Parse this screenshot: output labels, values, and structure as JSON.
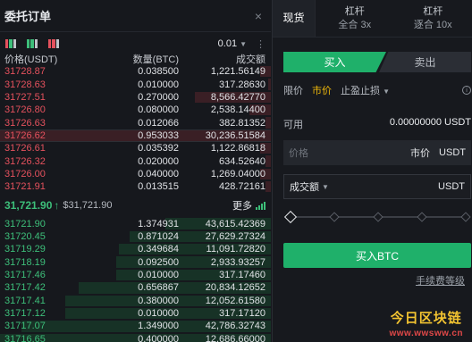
{
  "orderbook": {
    "title": "委托订单",
    "close_icon": "×",
    "precision": "0.01",
    "headers": {
      "price": "价格(USDT)",
      "qty": "数量(BTC)",
      "total": "成交额"
    },
    "asks": [
      {
        "price": "31728.87",
        "qty": "0.038500",
        "total": "1,221.56149",
        "depth": 0.04
      },
      {
        "price": "31728.63",
        "qty": "0.010000",
        "total": "317.28630",
        "depth": 0.01
      },
      {
        "price": "31727.51",
        "qty": "0.270000",
        "total": "8,566.42770",
        "depth": 0.28
      },
      {
        "price": "31726.80",
        "qty": "0.080000",
        "total": "2,538.14400",
        "depth": 0.08
      },
      {
        "price": "31726.63",
        "qty": "0.012066",
        "total": "382.81352",
        "depth": 0.02
      },
      {
        "price": "31726.62",
        "qty": "0.953033",
        "total": "30,236.51584",
        "depth": 1.0,
        "highlight": true
      },
      {
        "price": "31726.61",
        "qty": "0.035392",
        "total": "1,122.86818",
        "depth": 0.04
      },
      {
        "price": "31726.32",
        "qty": "0.020000",
        "total": "634.52640",
        "depth": 0.02
      },
      {
        "price": "31726.00",
        "qty": "0.040000",
        "total": "1,269.04000",
        "depth": 0.04
      },
      {
        "price": "31721.91",
        "qty": "0.013515",
        "total": "428.72161",
        "depth": 0.02
      }
    ],
    "last_price": "31,721.90",
    "mark_price": "$31,721.90",
    "more_label": "更多",
    "bids": [
      {
        "price": "31721.90",
        "qty": "1.374931",
        "total": "43,615.42369",
        "depth": 0.39
      },
      {
        "price": "31720.45",
        "qty": "0.871024",
        "total": "27,629.27324",
        "depth": 0.52
      },
      {
        "price": "31719.29",
        "qty": "0.349684",
        "total": "11,091.72820",
        "depth": 0.56
      },
      {
        "price": "31718.19",
        "qty": "0.092500",
        "total": "2,933.93257",
        "depth": 0.57
      },
      {
        "price": "31717.46",
        "qty": "0.010000",
        "total": "317.17460",
        "depth": 0.57
      },
      {
        "price": "31717.42",
        "qty": "0.656867",
        "total": "20,834.12652",
        "depth": 0.71
      },
      {
        "price": "31717.41",
        "qty": "0.380000",
        "total": "12,052.61580",
        "depth": 0.76
      },
      {
        "price": "31717.12",
        "qty": "0.010000",
        "total": "317.17120",
        "depth": 0.76
      },
      {
        "price": "31717.07",
        "qty": "1.349000",
        "total": "42,786.32743",
        "depth": 0.92
      },
      {
        "price": "31716.65",
        "qty": "0.400000",
        "total": "12,686.66000",
        "depth": 1.0
      }
    ]
  },
  "trade": {
    "tabs": [
      {
        "label": "现货",
        "sub": ""
      },
      {
        "label": "杠杆",
        "sub": "全合 3x"
      },
      {
        "label": "杠杆",
        "sub": "逐合 10x"
      }
    ],
    "buy_label": "买入",
    "sell_label": "卖出",
    "order_types": {
      "limit": "限价",
      "market": "市价",
      "stop": "止盈止损"
    },
    "available_label": "可用",
    "available_value": "0.00000000 USDT",
    "price_placeholder": "价格",
    "price_mode": "市价",
    "price_unit": "USDT",
    "amount_label": "成交额",
    "amount_unit": "USDT",
    "slider_percent": 0,
    "submit_label": "买入BTC",
    "fee_link": "手续费等级"
  },
  "watermark": {
    "title": "今日区块链",
    "url": "www.wwsww.cn"
  },
  "colors": {
    "ask": "#e4515d",
    "bid": "#3dbf7a",
    "accent": "#1fb06a",
    "active_tab": "#f0b90b"
  }
}
